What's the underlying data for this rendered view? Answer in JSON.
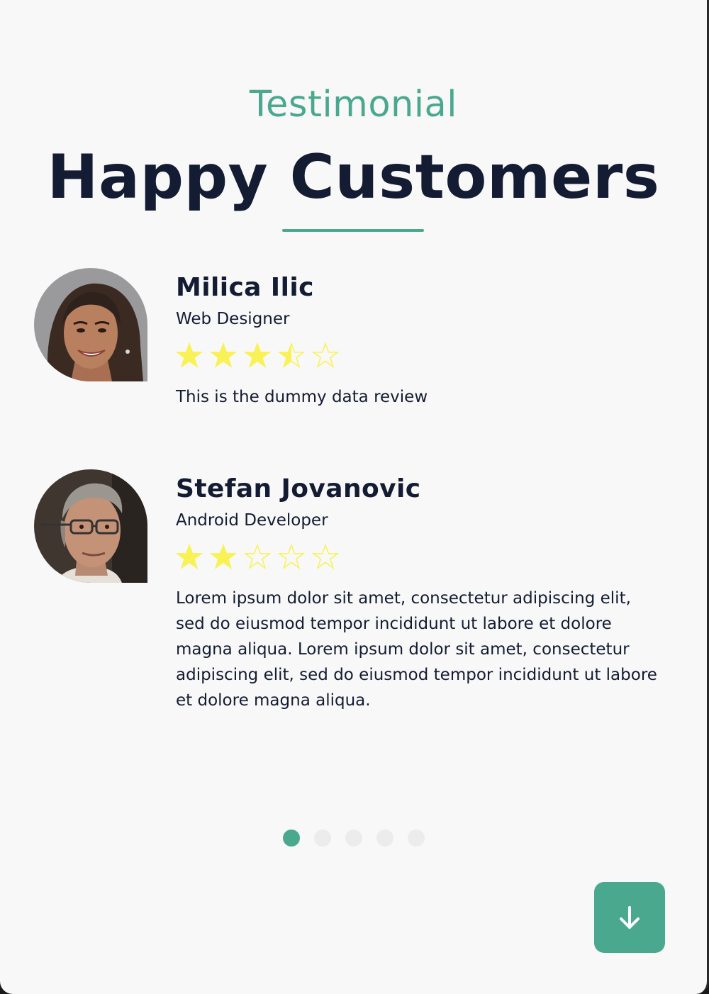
{
  "header": {
    "eyebrow": "Testimonial",
    "title": "Happy Customers"
  },
  "colors": {
    "accent": "#4aa88f",
    "text": "#141c33",
    "star": "#f8f256",
    "background": "#f8f8f8"
  },
  "reviews": [
    {
      "name": "Milica Ilic",
      "role": "Web Designer",
      "rating": 3.5,
      "max_rating": 5,
      "text": "This is the dummy data review",
      "avatar_icon": "woman-portrait"
    },
    {
      "name": "Stefan Jovanovic",
      "role": "Android Developer",
      "rating": 2,
      "max_rating": 5,
      "text": "Lorem ipsum dolor sit amet, consectetur adipiscing elit, sed do eiusmod tempor incididunt ut labore et dolore magna aliqua. Lorem ipsum dolor sit amet, consectetur adipiscing elit, sed do eiusmod tempor incididunt ut labore et dolore magna aliqua.",
      "avatar_icon": "man-portrait"
    }
  ],
  "pagination": {
    "total": 5,
    "active_index": 0
  },
  "scroll_button": {
    "icon": "arrow-down-icon"
  }
}
